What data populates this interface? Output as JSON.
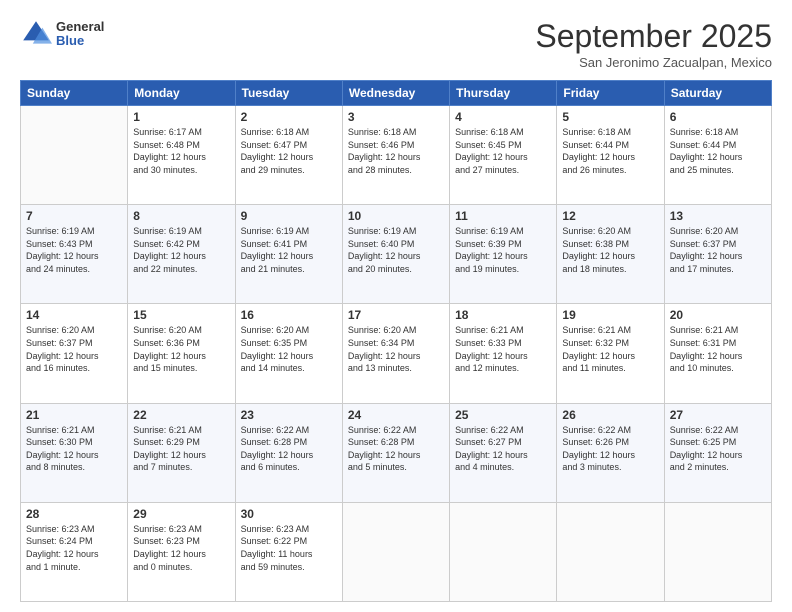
{
  "logo": {
    "general": "General",
    "blue": "Blue"
  },
  "header": {
    "month": "September 2025",
    "location": "San Jeronimo Zacualpan, Mexico"
  },
  "weekdays": [
    "Sunday",
    "Monday",
    "Tuesday",
    "Wednesday",
    "Thursday",
    "Friday",
    "Saturday"
  ],
  "weeks": [
    [
      {
        "day": "",
        "info": ""
      },
      {
        "day": "1",
        "info": "Sunrise: 6:17 AM\nSunset: 6:48 PM\nDaylight: 12 hours\nand 30 minutes."
      },
      {
        "day": "2",
        "info": "Sunrise: 6:18 AM\nSunset: 6:47 PM\nDaylight: 12 hours\nand 29 minutes."
      },
      {
        "day": "3",
        "info": "Sunrise: 6:18 AM\nSunset: 6:46 PM\nDaylight: 12 hours\nand 28 minutes."
      },
      {
        "day": "4",
        "info": "Sunrise: 6:18 AM\nSunset: 6:45 PM\nDaylight: 12 hours\nand 27 minutes."
      },
      {
        "day": "5",
        "info": "Sunrise: 6:18 AM\nSunset: 6:44 PM\nDaylight: 12 hours\nand 26 minutes."
      },
      {
        "day": "6",
        "info": "Sunrise: 6:18 AM\nSunset: 6:44 PM\nDaylight: 12 hours\nand 25 minutes."
      }
    ],
    [
      {
        "day": "7",
        "info": "Sunrise: 6:19 AM\nSunset: 6:43 PM\nDaylight: 12 hours\nand 24 minutes."
      },
      {
        "day": "8",
        "info": "Sunrise: 6:19 AM\nSunset: 6:42 PM\nDaylight: 12 hours\nand 22 minutes."
      },
      {
        "day": "9",
        "info": "Sunrise: 6:19 AM\nSunset: 6:41 PM\nDaylight: 12 hours\nand 21 minutes."
      },
      {
        "day": "10",
        "info": "Sunrise: 6:19 AM\nSunset: 6:40 PM\nDaylight: 12 hours\nand 20 minutes."
      },
      {
        "day": "11",
        "info": "Sunrise: 6:19 AM\nSunset: 6:39 PM\nDaylight: 12 hours\nand 19 minutes."
      },
      {
        "day": "12",
        "info": "Sunrise: 6:20 AM\nSunset: 6:38 PM\nDaylight: 12 hours\nand 18 minutes."
      },
      {
        "day": "13",
        "info": "Sunrise: 6:20 AM\nSunset: 6:37 PM\nDaylight: 12 hours\nand 17 minutes."
      }
    ],
    [
      {
        "day": "14",
        "info": "Sunrise: 6:20 AM\nSunset: 6:37 PM\nDaylight: 12 hours\nand 16 minutes."
      },
      {
        "day": "15",
        "info": "Sunrise: 6:20 AM\nSunset: 6:36 PM\nDaylight: 12 hours\nand 15 minutes."
      },
      {
        "day": "16",
        "info": "Sunrise: 6:20 AM\nSunset: 6:35 PM\nDaylight: 12 hours\nand 14 minutes."
      },
      {
        "day": "17",
        "info": "Sunrise: 6:20 AM\nSunset: 6:34 PM\nDaylight: 12 hours\nand 13 minutes."
      },
      {
        "day": "18",
        "info": "Sunrise: 6:21 AM\nSunset: 6:33 PM\nDaylight: 12 hours\nand 12 minutes."
      },
      {
        "day": "19",
        "info": "Sunrise: 6:21 AM\nSunset: 6:32 PM\nDaylight: 12 hours\nand 11 minutes."
      },
      {
        "day": "20",
        "info": "Sunrise: 6:21 AM\nSunset: 6:31 PM\nDaylight: 12 hours\nand 10 minutes."
      }
    ],
    [
      {
        "day": "21",
        "info": "Sunrise: 6:21 AM\nSunset: 6:30 PM\nDaylight: 12 hours\nand 8 minutes."
      },
      {
        "day": "22",
        "info": "Sunrise: 6:21 AM\nSunset: 6:29 PM\nDaylight: 12 hours\nand 7 minutes."
      },
      {
        "day": "23",
        "info": "Sunrise: 6:22 AM\nSunset: 6:28 PM\nDaylight: 12 hours\nand 6 minutes."
      },
      {
        "day": "24",
        "info": "Sunrise: 6:22 AM\nSunset: 6:28 PM\nDaylight: 12 hours\nand 5 minutes."
      },
      {
        "day": "25",
        "info": "Sunrise: 6:22 AM\nSunset: 6:27 PM\nDaylight: 12 hours\nand 4 minutes."
      },
      {
        "day": "26",
        "info": "Sunrise: 6:22 AM\nSunset: 6:26 PM\nDaylight: 12 hours\nand 3 minutes."
      },
      {
        "day": "27",
        "info": "Sunrise: 6:22 AM\nSunset: 6:25 PM\nDaylight: 12 hours\nand 2 minutes."
      }
    ],
    [
      {
        "day": "28",
        "info": "Sunrise: 6:23 AM\nSunset: 6:24 PM\nDaylight: 12 hours\nand 1 minute."
      },
      {
        "day": "29",
        "info": "Sunrise: 6:23 AM\nSunset: 6:23 PM\nDaylight: 12 hours\nand 0 minutes."
      },
      {
        "day": "30",
        "info": "Sunrise: 6:23 AM\nSunset: 6:22 PM\nDaylight: 11 hours\nand 59 minutes."
      },
      {
        "day": "",
        "info": ""
      },
      {
        "day": "",
        "info": ""
      },
      {
        "day": "",
        "info": ""
      },
      {
        "day": "",
        "info": ""
      }
    ]
  ]
}
